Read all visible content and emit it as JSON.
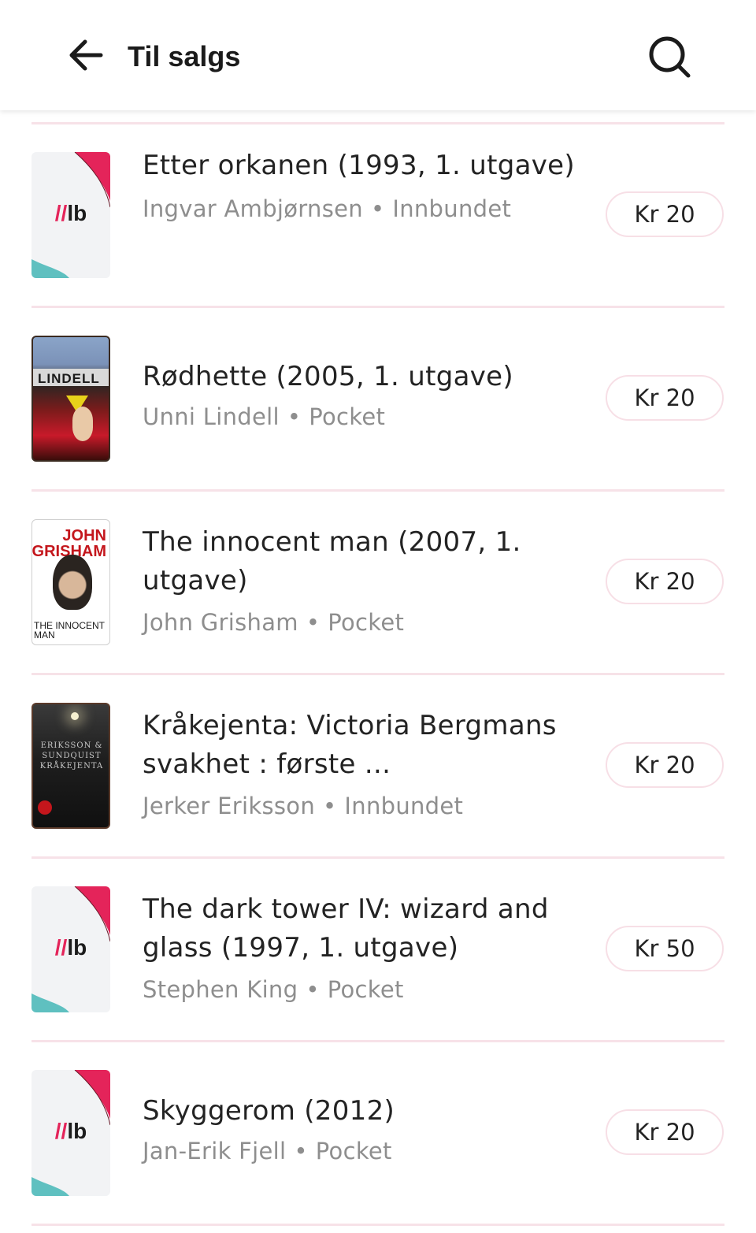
{
  "header": {
    "title": "Til salgs",
    "back_icon": "arrow-left-icon",
    "search_icon": "search-icon"
  },
  "colors": {
    "divider": "#f7e2e8",
    "price_border": "#f7dfe6",
    "muted_text": "#8e8e8e",
    "brand_pink": "#e4245a",
    "brand_teal": "#5fc0c0"
  },
  "listings": [
    {
      "title": "Etter orkanen (1993, 1. utgave)",
      "author": "Ingvar Ambjørnsen",
      "format": "Innbundet",
      "price": "Kr 20",
      "cover": "placeholder"
    },
    {
      "title": "Rødhette (2005, 1. utgave)",
      "author": "Unni Lindell",
      "format": "Pocket",
      "price": "Kr 20",
      "cover": "image",
      "cover_text": "LINDELL"
    },
    {
      "title": "The innocent man (2007, 1. utgave)",
      "author": "John Grisham",
      "format": "Pocket",
      "price": "Kr 20",
      "cover": "image",
      "cover_text": "JOHN GRISHAM",
      "cover_bottom_text": "THE INNOCENT MAN"
    },
    {
      "title": "Kråkejenta: Victoria Bergmans svakhet : første ...",
      "author": "Jerker Eriksson",
      "format": "Innbundet",
      "price": "Kr 20",
      "cover": "image",
      "cover_text": "ERIKSSON & SUNDQUIST KRÅKEJENTA"
    },
    {
      "title": "The dark tower IV: wizard and glass (1997, 1. utgave)",
      "author": "Stephen King",
      "format": "Pocket",
      "price": "Kr 50",
      "cover": "placeholder"
    },
    {
      "title": "Skyggerom (2012)",
      "author": "Jan-Erik Fjell",
      "format": "Pocket",
      "price": "Kr 20",
      "cover": "placeholder"
    }
  ],
  "separator": "•",
  "logo_text": "lb"
}
